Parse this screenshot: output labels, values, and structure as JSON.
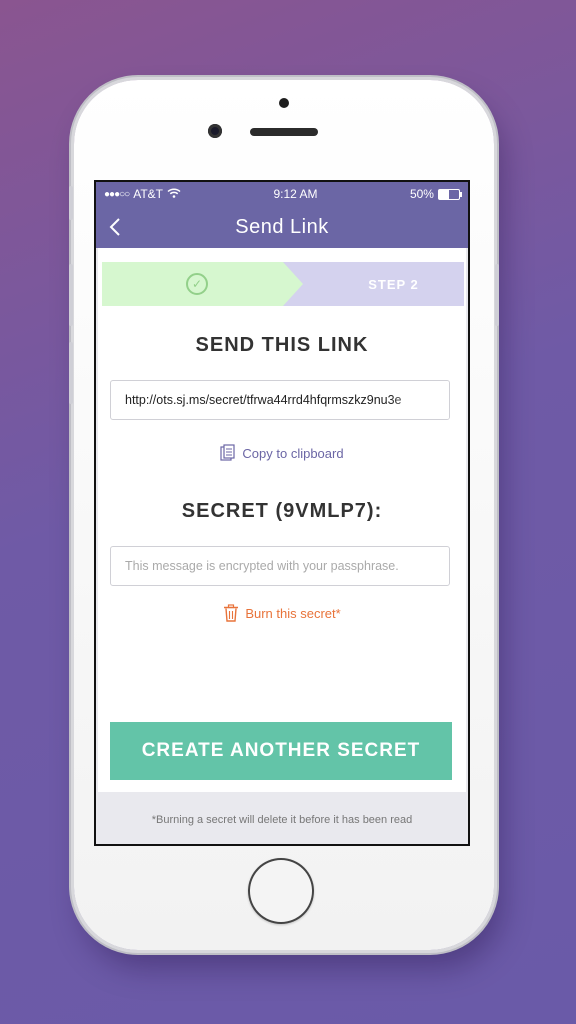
{
  "status_bar": {
    "signal": "●●●○○",
    "carrier": "AT&T",
    "wifi_icon": "wifi-icon",
    "time": "9:12 AM",
    "battery": "50%",
    "battery_level": 0.5
  },
  "nav": {
    "back_icon": "chevron-left-icon",
    "title": "Send Link"
  },
  "steps": {
    "step1_icon": "check-circle-icon",
    "step2_label": "STEP 2"
  },
  "link_section": {
    "heading": "SEND THIS LINK",
    "link_value": "http://ots.sj.ms/secret/tfrwa44rrd4hfqrmszkz9nu3e",
    "copy_icon": "clipboard-icon",
    "copy_label": "Copy to clipboard"
  },
  "secret_section": {
    "heading": "SECRET (9VMLP7):",
    "placeholder": "This message is encrypted with your passphrase.",
    "burn_icon": "trash-icon",
    "burn_label": "Burn this secret*"
  },
  "cta": {
    "label": "CREATE ANOTHER SECRET"
  },
  "footnote": "*Burning a secret will delete it before it has been read",
  "colors": {
    "header": "#6b66a5",
    "step1": "#d6f7cf",
    "step2": "#d4d2ee",
    "cta": "#63c4a8",
    "burn": "#e8733a",
    "copy": "#6b66a5"
  }
}
